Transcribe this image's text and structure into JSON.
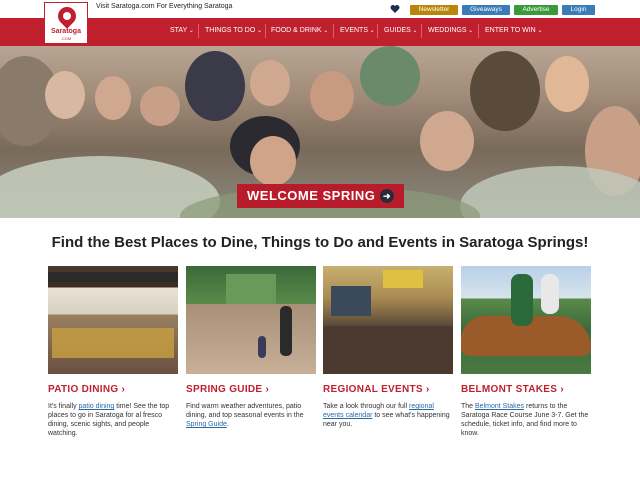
{
  "topbar": {
    "tagline": "Visit Saratoga.com For Everything Saratoga",
    "buttons": {
      "newsletter": "Newsletter",
      "giveaways": "Giveaways",
      "advertise": "Advertise",
      "login": "Login"
    }
  },
  "logo": {
    "name": "Saratoga",
    "sub": ".COM"
  },
  "nav": {
    "items": [
      "STAY",
      "THINGS TO DO",
      "FOOD & DRINK",
      "EVENTS",
      "GUIDES",
      "WEDDINGS",
      "ENTER TO WIN"
    ]
  },
  "hero": {
    "button_label": "WELCOME SPRING"
  },
  "headline": "Find the Best Places to Dine, Things to Do and Events in Saratoga Springs!",
  "cards": [
    {
      "title": "PATIO DINING",
      "desc_before": "It's finally ",
      "link": "patio dining",
      "desc_after": " time! See the top places to go in Saratoga for al fresco dining, scenic sights, and people watching."
    },
    {
      "title": "SPRING GUIDE",
      "desc_before": "Find warm weather adventures, patio dining, and top seasonal events in the ",
      "link": "Spring Guide",
      "desc_after": "."
    },
    {
      "title": "REGIONAL EVENTS",
      "desc_before": "Take a look through our full ",
      "link": "regional events calendar",
      "desc_after": " to see what's happening near you."
    },
    {
      "title": "BELMONT STAKES",
      "desc_before": "The ",
      "link": "Belmont Stakes",
      "desc_after": " returns to the Saratoga Race Course June 3-7. Get the schedule, ticket info, and find more to know."
    }
  ],
  "colors": {
    "brand_red": "#c0202e",
    "link_blue": "#2a6aa8"
  }
}
